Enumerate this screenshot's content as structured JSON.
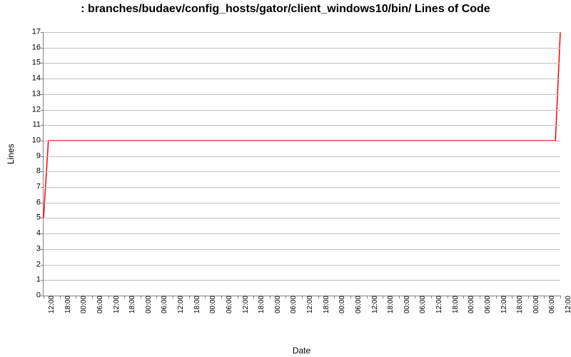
{
  "chart_data": {
    "type": "line",
    "title": ": branches/budaev/config_hosts/gator/client_windows10/bin/ Lines of Code",
    "xlabel": "Date",
    "ylabel": "Lines",
    "ylim": [
      0,
      17
    ],
    "y_ticks": [
      0,
      1,
      2,
      3,
      4,
      5,
      6,
      7,
      8,
      9,
      10,
      11,
      12,
      13,
      14,
      15,
      16,
      17
    ],
    "x_tick_labels": [
      "12:00",
      "18:00",
      "00:00",
      "06:00",
      "12:00",
      "18:00",
      "00:00",
      "06:00",
      "12:00",
      "18:00",
      "00:00",
      "06:00",
      "12:00",
      "18:00",
      "00:00",
      "06:00",
      "12:00",
      "18:00",
      "00:00",
      "06:00",
      "12:00",
      "18:00",
      "00:00",
      "06:00",
      "12:00",
      "18:00",
      "00:00",
      "06:00",
      "12:00",
      "18:00",
      "00:00",
      "06:00",
      "12:00"
    ],
    "series": [
      {
        "name": "Lines of Code",
        "color": "#ff0000",
        "x_index": [
          0,
          0.3,
          31.7,
          32
        ],
        "y": [
          5,
          10,
          10,
          17
        ]
      }
    ]
  }
}
